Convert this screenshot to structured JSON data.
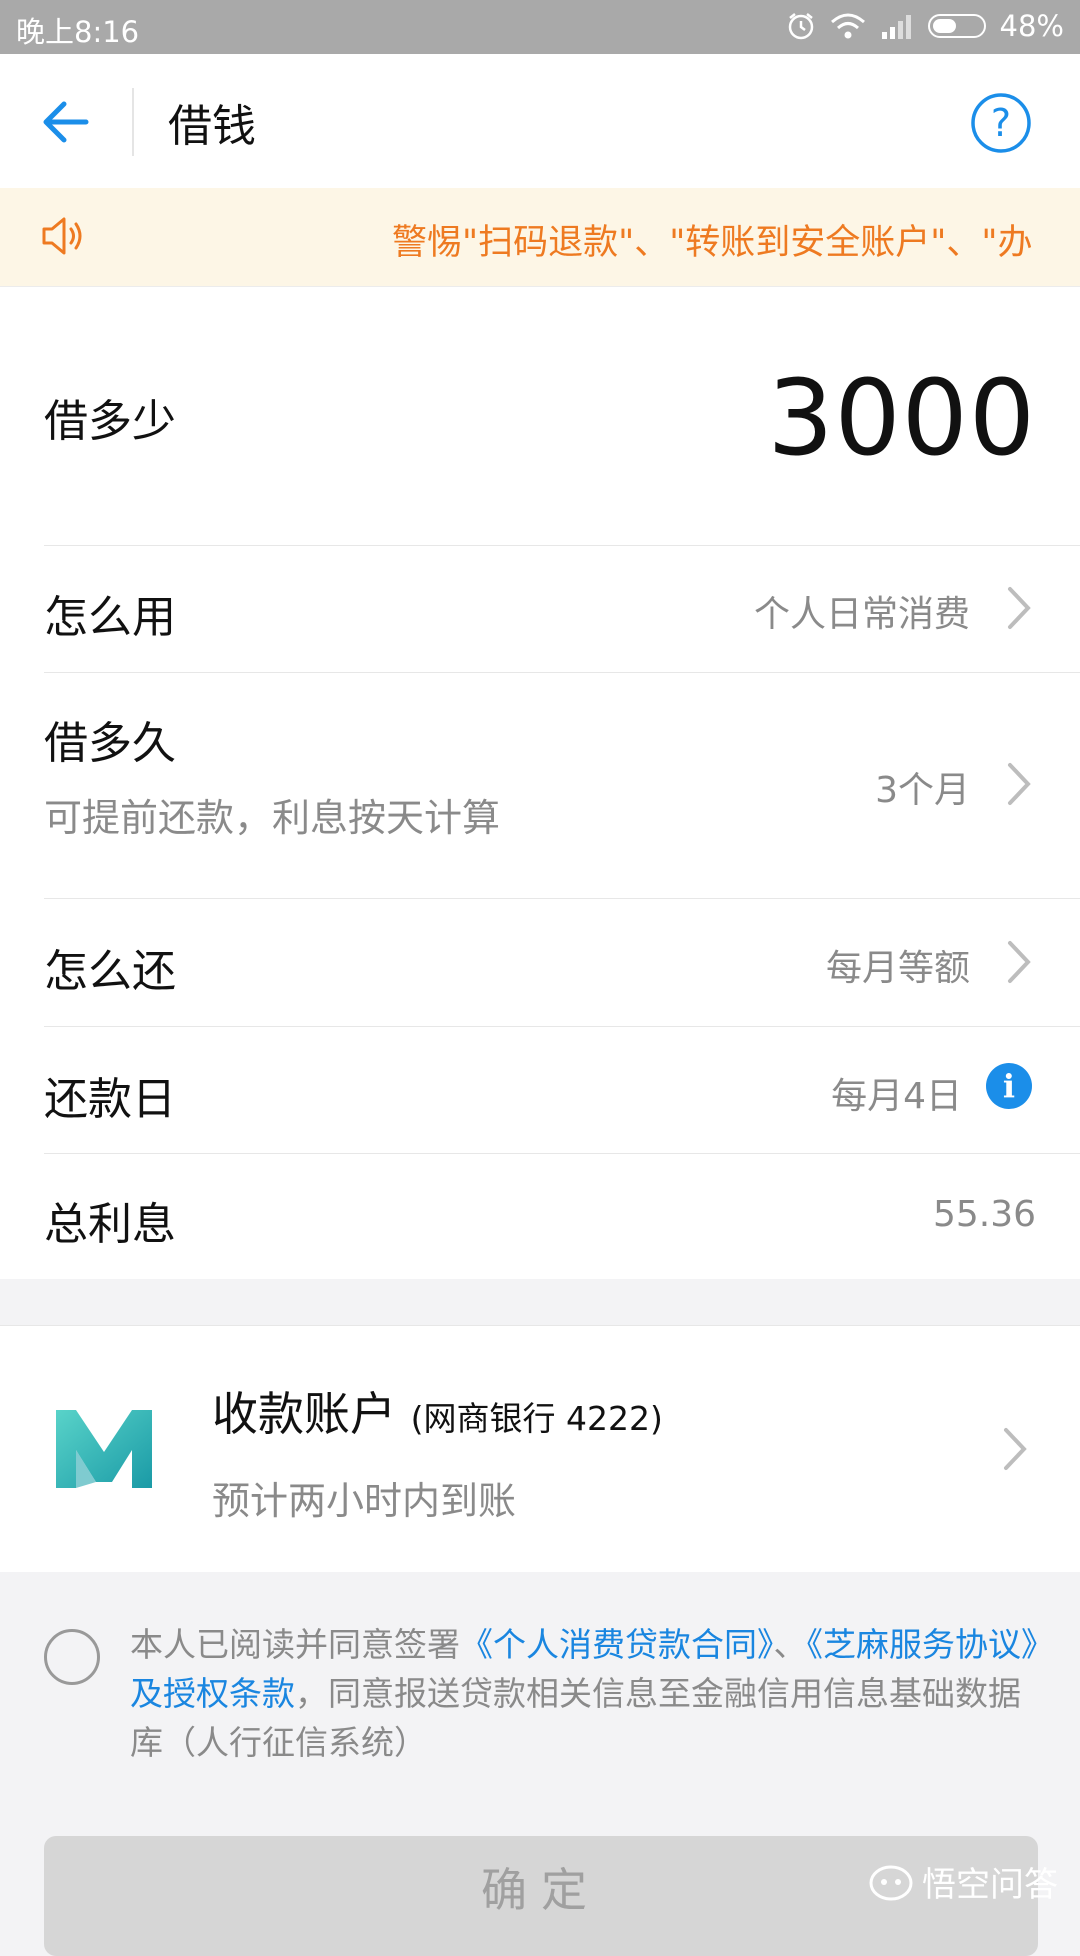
{
  "status_bar": {
    "time": "晚上8:16",
    "battery": "48%",
    "battery_level": 0.48
  },
  "header": {
    "title": "借钱"
  },
  "notice": {
    "text": "警惕\"扫码退款\"、\"转账到安全账户\"、\"办"
  },
  "form": {
    "amount": {
      "label": "借多少",
      "value": "3000"
    },
    "usage": {
      "label": "怎么用",
      "value": "个人日常消费"
    },
    "term": {
      "label": "借多久",
      "sublabel": "可提前还款，利息按天计算",
      "value": "3个月"
    },
    "repay_method": {
      "label": "怎么还",
      "value": "每月等额"
    },
    "repay_day": {
      "label": "还款日",
      "value": "每月4日",
      "info_icon": "i"
    },
    "interest": {
      "label": "总利息",
      "value": "55.36"
    }
  },
  "account": {
    "title": "收款账户",
    "bank": "(网商银行 4222)",
    "subtitle": "预计两小时内到账"
  },
  "agreement": {
    "prefix": "本人已阅读并同意签署",
    "link1": "《个人消费贷款合同》",
    "sep": "、",
    "link2": "《芝麻服务协议》及授权条款",
    "suffix": "，同意报送贷款相关信息至金融信用信息基础数据库（人行征信系统）"
  },
  "confirm_label": "确定",
  "watermark": "悟空问答",
  "colors": {
    "accent": "#1b8ee9",
    "notice": "#ee7a21",
    "link": "#1a86e0"
  }
}
